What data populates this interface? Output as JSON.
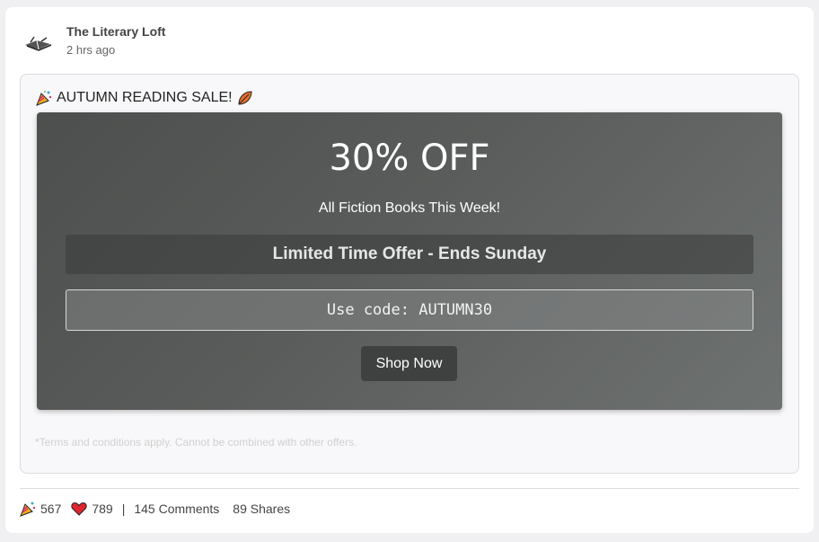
{
  "post": {
    "author": "The Literary Loft",
    "time": "2 hrs ago",
    "avatar_icon": "flying-book-icon",
    "headline": "AUTUMN READING SALE!",
    "headline_icons": [
      "party-popper-icon",
      "fallen-leaf-icon"
    ]
  },
  "banner": {
    "discount": "30% OFF",
    "subtitle": "All Fiction Books This Week!",
    "limited_offer": "Limited Time Offer - Ends Sunday",
    "code_text": "Use code: AUTUMN30",
    "shop_label": "Shop Now"
  },
  "terms": "*Terms and conditions apply. Cannot be combined with other offers.",
  "reactions": {
    "party_count": "567",
    "heart_count": "789",
    "separator": "|",
    "comments": "145 Comments",
    "shares": "89 Shares"
  },
  "colors": {
    "banner_dark": "#4d4f4e",
    "banner_light": "#6e7271",
    "heart": "#e0252e",
    "leaf": "#e8702a"
  }
}
